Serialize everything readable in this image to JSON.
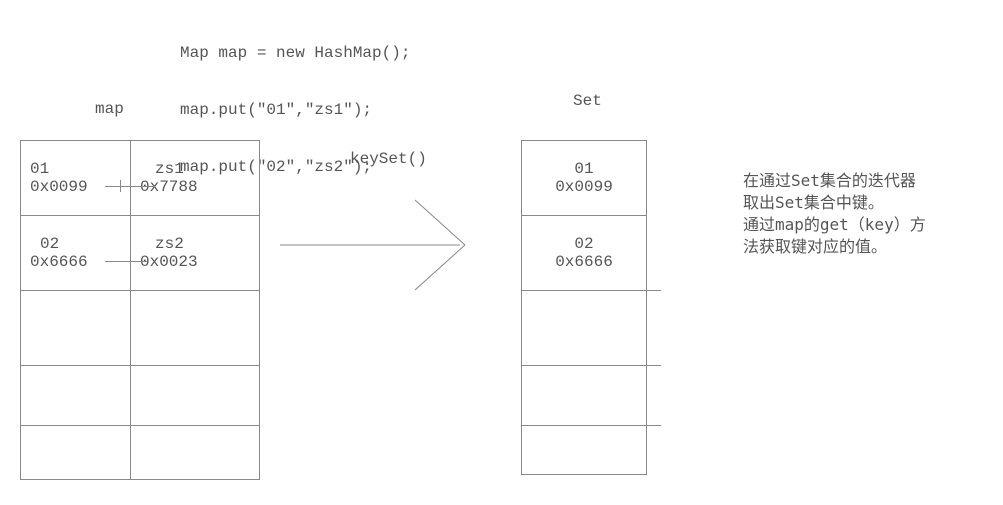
{
  "code": {
    "line1": "Map map = new HashMap();",
    "line2": "map.put(\"01\",\"zs1\");",
    "line3": "map.put(\"02\",\"zs2\");"
  },
  "labels": {
    "map": "map",
    "set": "Set",
    "keyset": "keySet()"
  },
  "map_entries": [
    {
      "key": "01",
      "key_addr": "0x0099",
      "val": "zs1",
      "val_addr": "0x7788"
    },
    {
      "key": "02",
      "key_addr": "0x6666",
      "val": "zs2",
      "val_addr": "0x0023"
    }
  ],
  "set_entries": [
    {
      "key": "01",
      "addr": "0x0099"
    },
    {
      "key": "02",
      "addr": "0x6666"
    }
  ],
  "explanation": {
    "l1": "在通过Set集合的迭代器",
    "l2": "取出Set集合中键。",
    "l3": "通过map的get（key）方",
    "l4": "法获取键对应的值。"
  }
}
